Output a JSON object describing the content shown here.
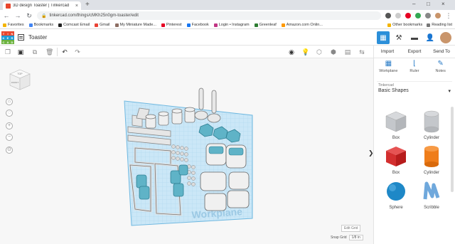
{
  "browser": {
    "tab_title": "3D design Toaster | Tinkercad",
    "tab_close": "×",
    "new_tab": "+",
    "window_controls": [
      "–",
      "□",
      "×"
    ],
    "url": "tinkercad.com/things/cMKh25n0gm-toaster/edit",
    "back": "←",
    "forward": "→",
    "reload": "↻",
    "lock_icon": "🔒"
  },
  "bookmarks": {
    "items": [
      {
        "label": "Favorites",
        "color": "#f4b400"
      },
      {
        "label": "Bookmarks",
        "color": "#4285f4"
      },
      {
        "label": "Comcast Email",
        "color": "#222222"
      },
      {
        "label": "Gmail",
        "color": "#ea4335"
      },
      {
        "label": "My Miniature Made...",
        "color": "#8d6e63"
      },
      {
        "label": "Pinterest",
        "color": "#e60023"
      },
      {
        "label": "Facebook",
        "color": "#1877f2"
      },
      {
        "label": "Login • Instagram",
        "color": "#c13584"
      },
      {
        "label": "Greenleaf",
        "color": "#2e7d32"
      },
      {
        "label": "Amazon.com Onlin...",
        "color": "#ff9900"
      }
    ],
    "other": "Other bookmarks",
    "reading": "Reading list"
  },
  "header": {
    "logo_letters": [
      "TIN",
      "KER",
      "CAD"
    ],
    "design_name": "Toaster",
    "accent": "#2b8fd9"
  },
  "panel": {
    "import": "Import",
    "export": "Export",
    "send_to": "Send To",
    "tools": [
      {
        "label": "Workplane",
        "icon": "workplane-icon"
      },
      {
        "label": "Ruler",
        "icon": "ruler-icon"
      },
      {
        "label": "Notes",
        "icon": "notes-icon"
      }
    ],
    "library_category": "Tinkercad",
    "library_selected": "Basic Shapes",
    "shapes": [
      {
        "label": "Box",
        "color": "#bfc3c8"
      },
      {
        "label": "Cylinder",
        "color": "#bfc3c8"
      },
      {
        "label": "Box",
        "color": "#d32f2f"
      },
      {
        "label": "Cylinder",
        "color": "#ef7d1a"
      },
      {
        "label": "Sphere",
        "color": "#1e88c7"
      },
      {
        "label": "Scribble",
        "color": "#6fa8dc"
      }
    ]
  },
  "workspace": {
    "viewcube_top": "TOP",
    "viewcube_front": "FRONT",
    "workplane_label": "Workplane",
    "edit_grid": "Edit Grid",
    "snap_label": "Snap Grid",
    "snap_value": "1/8 in",
    "collapse": "❯"
  }
}
